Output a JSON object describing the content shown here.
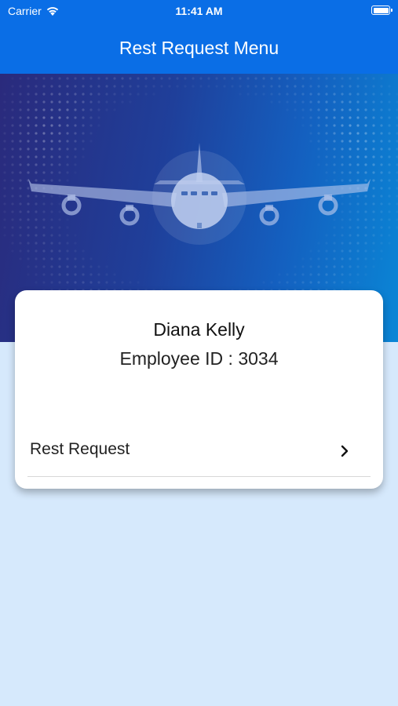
{
  "status_bar": {
    "carrier": "Carrier",
    "time": "11:41 AM",
    "icons": [
      "wifi-icon",
      "battery-icon"
    ]
  },
  "nav": {
    "title": "Rest Request Menu"
  },
  "hero": {
    "image": "airplane-illustration"
  },
  "card": {
    "name": "Diana Kelly",
    "employee_id": "Employee ID : 3034",
    "menu": [
      {
        "label": "Rest Request",
        "icon": "chevron-right-icon"
      }
    ]
  },
  "colors": {
    "nav_background": "#0a6ee6",
    "page_background": "#d6e9fc",
    "hero_gradient_start": "#2a2a7c",
    "hero_gradient_end": "#0a86d6",
    "card_background": "#ffffff"
  }
}
